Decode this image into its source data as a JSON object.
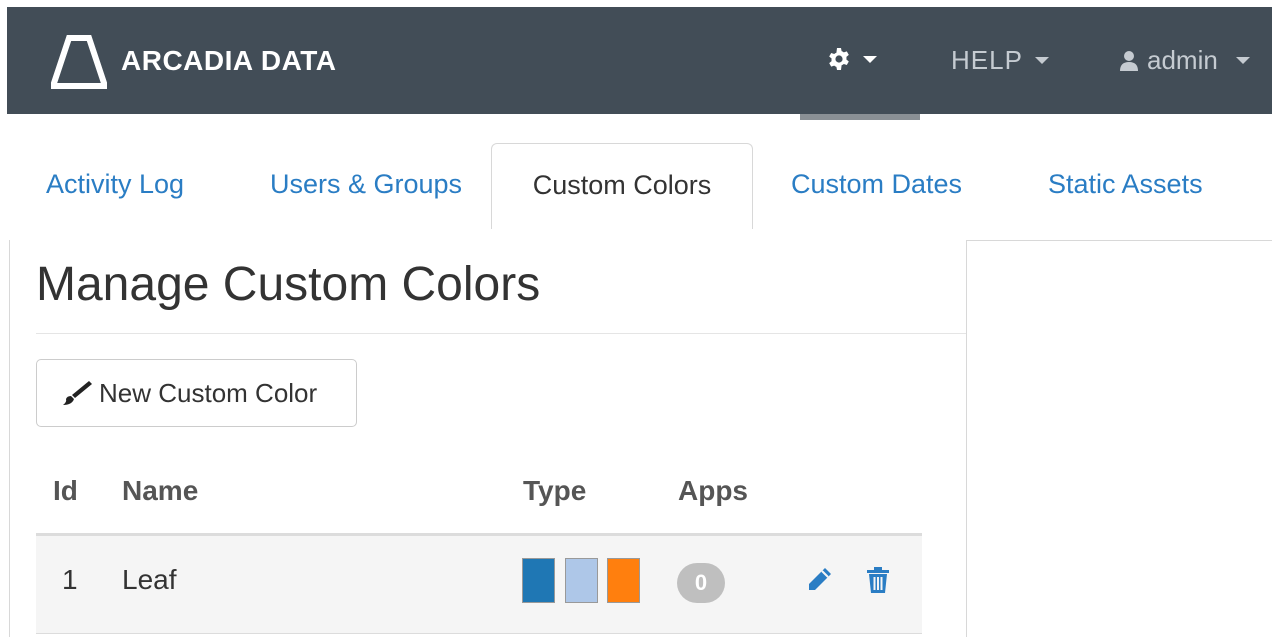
{
  "navbar": {
    "brand": "ARCADIA DATA",
    "help_label": "HELP",
    "user_label": "admin",
    "background_color": "#424d57"
  },
  "tabs": [
    {
      "label": "Activity Log",
      "active": false
    },
    {
      "label": "Users & Groups",
      "active": false
    },
    {
      "label": "Custom Colors",
      "active": true
    },
    {
      "label": "Custom Dates",
      "active": false
    },
    {
      "label": "Static Assets",
      "active": false
    }
  ],
  "page": {
    "title": "Manage Custom Colors",
    "new_button_label": "New Custom Color"
  },
  "table": {
    "columns": [
      "Id",
      "Name",
      "Type",
      "Apps"
    ],
    "rows": [
      {
        "id": "1",
        "name": "Leaf",
        "type_swatches": [
          "#1f77b4",
          "#aec7e8",
          "#ff7f0e"
        ],
        "apps": "0"
      }
    ]
  },
  "colors": {
    "link": "#2a7dc4",
    "icon_blue": "#2a7dc4",
    "badge_grey": "#bfbfbf"
  },
  "icons": {
    "logo": "triangle-logo-icon",
    "settings": "gear-icon",
    "user": "user-icon",
    "new_button": "paintbrush-icon",
    "edit": "pencil-icon",
    "delete": "trash-icon"
  }
}
